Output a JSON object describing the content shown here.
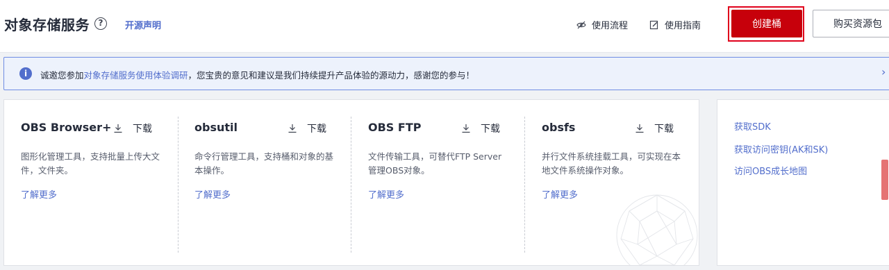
{
  "header": {
    "title": "对象存储服务",
    "help_icon": "?",
    "opensource_link": "开源声明",
    "flow_link": "使用流程",
    "guide_link": "使用指南",
    "create_button": "创建桶",
    "buy_button": "购买资源包"
  },
  "notice": {
    "icon": "i",
    "text_prefix": "诚邀您参加",
    "survey_link": "对象存储服务使用体验调研",
    "text_suffix": "，您宝贵的意见和建议是我们持续提升产品体验的源动力，感谢您的参与！",
    "chevron": "›"
  },
  "tools": [
    {
      "name": "OBS Browser+",
      "download": "下载",
      "desc": "图形化管理工具，支持批量上传大文件，文件夹。",
      "more": "了解更多"
    },
    {
      "name": "obsutil",
      "download": "下载",
      "desc": "命令行管理工具，支持桶和对象的基本操作。",
      "more": "了解更多"
    },
    {
      "name": "OBS FTP",
      "download": "下载",
      "desc": "文件传输工具，可替代FTP Server管理OBS对象。",
      "more": "了解更多"
    },
    {
      "name": "obsfs",
      "download": "下载",
      "desc": "并行文件系统挂载工具，可实现在本地文件系统操作对象。",
      "more": "了解更多"
    }
  ],
  "side_links": [
    "获取SDK",
    "获取访问密钥(AK和SK)",
    "访问OBS成长地图"
  ],
  "colors": {
    "accent": "#526ecc",
    "primary_button": "#c7000b",
    "highlight_border": "#e0001b",
    "notice_bg": "#edf2fc"
  }
}
